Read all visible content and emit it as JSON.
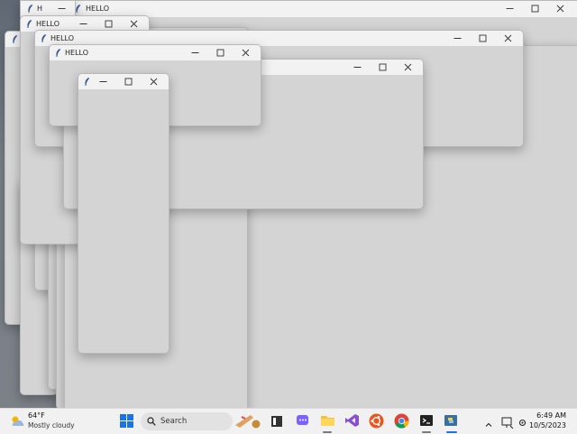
{
  "windows": [
    {
      "id": "w-back-right",
      "title": "HELLO",
      "show_icon": true,
      "show_title": true,
      "controls": true
    },
    {
      "id": "w-back-small",
      "title": "H",
      "show_icon": true,
      "show_title": true,
      "controls": true
    },
    {
      "id": "w-mid-left",
      "title": "HELLO",
      "show_icon": true,
      "show_title": true,
      "controls": true
    },
    {
      "id": "w-left-edge",
      "title": "",
      "show_icon": true,
      "show_title": false,
      "controls": false
    },
    {
      "id": "w-big",
      "title": "",
      "show_icon": false,
      "show_title": false,
      "controls": false
    },
    {
      "id": "w-second-tall",
      "title": "",
      "show_icon": false,
      "show_title": false,
      "controls": false
    },
    {
      "id": "w-hello-wide",
      "title": "HELLO",
      "show_icon": true,
      "show_title": true,
      "controls": true
    },
    {
      "id": "w-right-box",
      "title": "",
      "show_icon": false,
      "show_title": false,
      "controls": true
    },
    {
      "id": "w-hello-front",
      "title": "HELLO",
      "show_icon": true,
      "show_title": true,
      "controls": true
    },
    {
      "id": "w-narrow",
      "title": "",
      "show_icon": true,
      "show_title": false,
      "controls": true
    }
  ],
  "taskbar": {
    "weather": {
      "temp": "64°F",
      "desc": "Mostly cloudy"
    },
    "search_label": "Search",
    "clock": {
      "time": "6:49 AM",
      "date": "10/5/2023"
    },
    "apps": [
      "start",
      "search",
      "paint-tools",
      "file-manager",
      "teams",
      "file-explorer",
      "visual-studio",
      "ubuntu",
      "chrome",
      "terminal",
      "python-app"
    ],
    "tray": [
      "chevron-up",
      "network-display",
      "settings-audio"
    ]
  },
  "colors": {
    "accent": "#1a73e8",
    "window_body": "#d4d4d4",
    "titlebar": "#f2f2f2",
    "taskbar": "#f1f1f1"
  }
}
